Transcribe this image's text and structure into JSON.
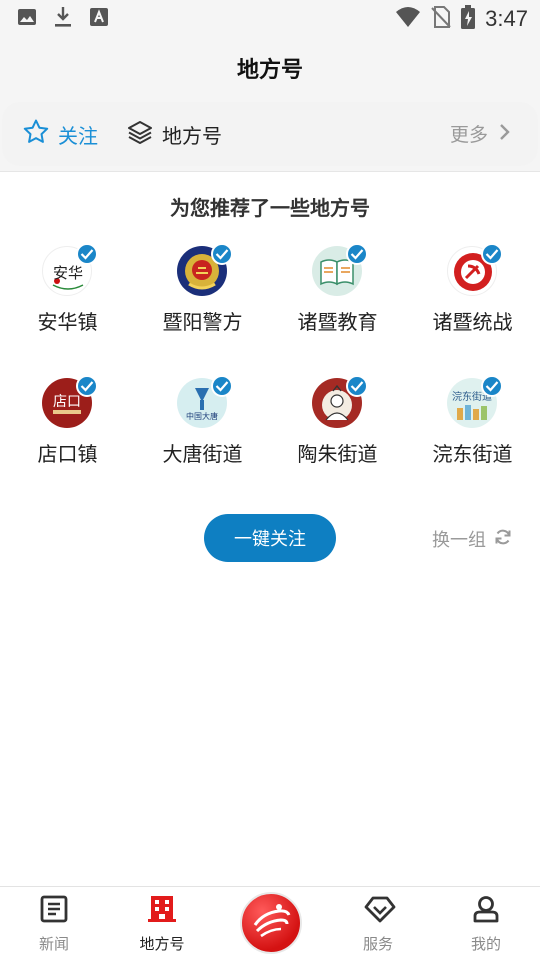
{
  "status_bar": {
    "time": "3:47"
  },
  "header": {
    "title": "地方号"
  },
  "filter_bar": {
    "follow_label": "关注",
    "local_label": "地方号",
    "more_label": "更多"
  },
  "recommend": {
    "title": "为您推荐了一些地方号",
    "items": [
      {
        "name": "安华镇",
        "badge": "安华"
      },
      {
        "name": "暨阳警方",
        "badge": ""
      },
      {
        "name": "诸暨教育",
        "badge": ""
      },
      {
        "name": "诸暨统战",
        "badge": ""
      },
      {
        "name": "店口镇",
        "badge": "店口"
      },
      {
        "name": "大唐街道",
        "badge": "中国大唐"
      },
      {
        "name": "陶朱街道",
        "badge": ""
      },
      {
        "name": "浣东街道",
        "badge": "浣东街道"
      }
    ],
    "follow_all_label": "一键关注",
    "refresh_label": "换一组"
  },
  "bottom_nav": {
    "items": [
      {
        "label": "新闻"
      },
      {
        "label": "地方号"
      },
      {
        "label": "服务"
      },
      {
        "label": "我的"
      }
    ]
  },
  "colors": {
    "accent": "#1a86c8",
    "brand_red": "#e21b1b"
  }
}
